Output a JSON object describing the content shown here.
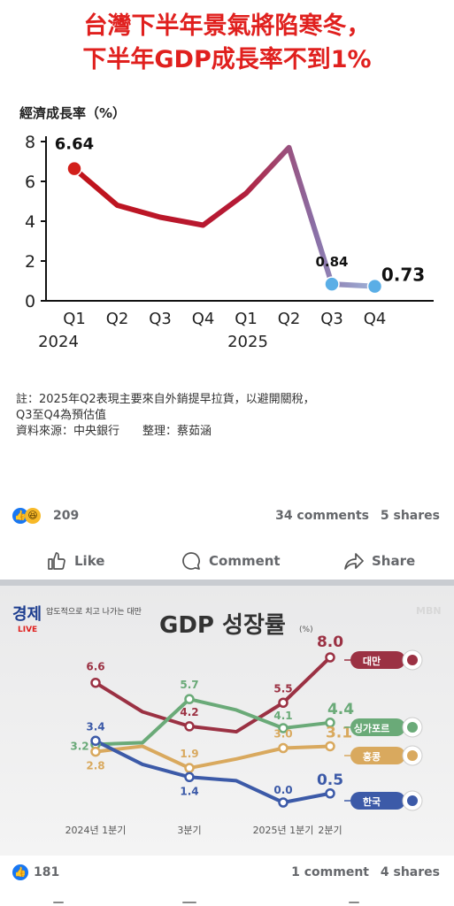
{
  "post1": {
    "headline_line1": "台灣下半年景氣將陷寒冬，",
    "headline_line2": "下半年GDP成長率不到1%",
    "chart_title": "經濟成長率（%）",
    "note_line1": "註：2025年Q2表現主要來自外銷提早拉貨，以避開關稅，",
    "note_line2": "Q3至Q4為預估值",
    "note_line3": "資料來源：中央銀行　　整理：蔡茹涵",
    "reactions_count": "209",
    "comments": "34 comments",
    "shares": "5 shares",
    "like_label": "Like",
    "comment_label": "Comment",
    "share_label": "Share"
  },
  "post2": {
    "logo_text": "경제",
    "logo_live": "LIVE",
    "ticker": "압도적으로 치고 나가는 대만",
    "broadcaster": "MBN",
    "title": "GDP 성장률",
    "unit": "(%)",
    "reactions_count": "181",
    "comments": "1 comment",
    "shares": "4 shares"
  },
  "chart_data": [
    {
      "type": "line",
      "title": "經濟成長率（%）",
      "categories": [
        "Q1",
        "Q2",
        "Q3",
        "Q4",
        "Q1",
        "Q2",
        "Q3",
        "Q4"
      ],
      "year_labels": [
        "2024",
        "2025"
      ],
      "values": [
        6.64,
        4.8,
        4.2,
        3.8,
        5.4,
        7.7,
        0.84,
        0.73
      ],
      "value_labels": {
        "0": "6.64",
        "6": "0.84",
        "7": "0.73"
      },
      "yticks": [
        "0",
        "2",
        "4",
        "6",
        "8"
      ],
      "ylim": [
        0,
        8
      ],
      "line_color_start": "#c0131a",
      "line_color_end": "#9fb3d8",
      "point_color_red": "#d21f1a",
      "point_color_blue": "#5aaee6"
    },
    {
      "type": "line",
      "title": "GDP 성장률",
      "categories": [
        "2024년 1분기",
        "",
        "3분기",
        "",
        "2025년 1분기",
        "2분기"
      ],
      "series": [
        {
          "name": "대만",
          "color": "#9b3143",
          "values": [
            6.6,
            5.0,
            4.2,
            3.9,
            5.5,
            8.0
          ],
          "labels": [
            "6.6",
            "",
            "4.2",
            "",
            "5.5",
            "8.0"
          ]
        },
        {
          "name": "싱가포르",
          "color": "#6aaa78",
          "values": [
            3.2,
            3.3,
            5.7,
            5.1,
            4.1,
            4.4
          ],
          "labels": [
            "3.2",
            "",
            "5.7",
            "",
            "4.1",
            "4.4"
          ]
        },
        {
          "name": "홍콩",
          "color": "#d9a95e",
          "values": [
            2.8,
            3.1,
            1.9,
            2.4,
            3.0,
            3.1
          ],
          "labels": [
            "2.8",
            "",
            "1.9",
            "",
            "3.0",
            "3.1"
          ]
        },
        {
          "name": "한국",
          "color": "#3c5aa8",
          "values": [
            3.4,
            2.1,
            1.4,
            1.2,
            0.0,
            0.5
          ],
          "labels": [
            "3.4",
            "",
            "1.4",
            "",
            "0.0",
            "0.5"
          ]
        }
      ]
    }
  ]
}
